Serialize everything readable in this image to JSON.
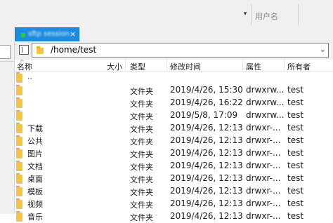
{
  "top": {
    "user_col": "用户名",
    "user_col_value": ""
  },
  "tab": {
    "label": "sftp session",
    "close": "×"
  },
  "path": {
    "value": "/home/test"
  },
  "columns": {
    "name": "名称",
    "size": "大小",
    "type": "类型",
    "mtime": "修改时间",
    "perm": "属性",
    "owner": "所有者"
  },
  "rows": [
    {
      "name": "..",
      "type": "",
      "mtime": "",
      "perm": "",
      "owner": ""
    },
    {
      "name": "",
      "type": "文件夹",
      "mtime": "2019/4/26, 15:30",
      "perm": "drwxrw...",
      "owner": "test"
    },
    {
      "name": "",
      "type": "文件夹",
      "mtime": "2019/4/26, 16:22",
      "perm": "drwxrw...",
      "owner": "test"
    },
    {
      "name": "",
      "type": "文件夹",
      "mtime": "2019/5/8, 17:09",
      "perm": "drwxrw...",
      "owner": "test"
    },
    {
      "name": "下载",
      "type": "文件夹",
      "mtime": "2019/4/26, 12:13",
      "perm": "drwxr-...",
      "owner": "test"
    },
    {
      "name": "公共",
      "type": "文件夹",
      "mtime": "2019/4/26, 12:13",
      "perm": "drwxr-...",
      "owner": "test"
    },
    {
      "name": "图片",
      "type": "文件夹",
      "mtime": "2019/4/26, 12:13",
      "perm": "drwxr-...",
      "owner": "test"
    },
    {
      "name": "文档",
      "type": "文件夹",
      "mtime": "2019/4/26, 12:13",
      "perm": "drwxr-...",
      "owner": "test"
    },
    {
      "name": "桌面",
      "type": "文件夹",
      "mtime": "2019/4/26, 12:13",
      "perm": "drwxr-...",
      "owner": "test"
    },
    {
      "name": "模板",
      "type": "文件夹",
      "mtime": "2019/4/26, 12:13",
      "perm": "drwxr-...",
      "owner": "test"
    },
    {
      "name": "视频",
      "type": "文件夹",
      "mtime": "2019/4/26, 12:13",
      "perm": "drwxr-...",
      "owner": "test"
    },
    {
      "name": "音乐",
      "type": "文件夹",
      "mtime": "2019/4/26, 12:13",
      "perm": "drwxr-...",
      "owner": "test"
    }
  ],
  "colors": {
    "tab_active": "#1c8ce0",
    "folder": "#f5c542",
    "status_dot": "#28c940"
  },
  "icons": {
    "folder": "folder-icon",
    "sidebar_toggle": "sidebar-toggle-icon",
    "dropdown": "chevron-down-icon",
    "close": "close-icon",
    "sort": "sort-up-icon"
  }
}
